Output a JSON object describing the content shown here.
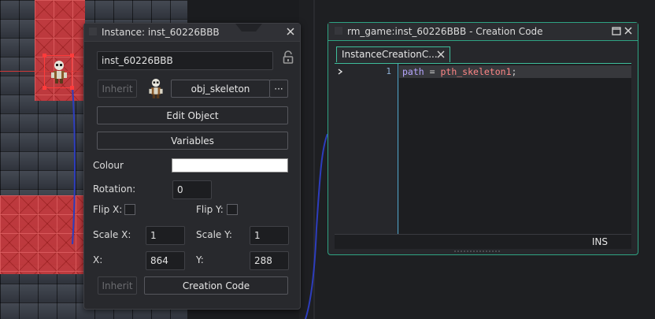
{
  "instance_panel": {
    "title": "Instance: inst_60226BBB",
    "name_value": "inst_60226BBB",
    "inherit_label": "Inherit",
    "object_name": "obj_skeleton",
    "more_label": "···",
    "edit_object_label": "Edit Object",
    "variables_label": "Variables",
    "colour_label": "Colour",
    "colour_value": "#ffffff",
    "rotation_label": "Rotation:",
    "rotation_value": "0",
    "flip_x_label": "Flip X:",
    "flip_y_label": "Flip Y:",
    "flip_x_checked": false,
    "flip_y_checked": false,
    "scale_x_label": "Scale X:",
    "scale_x_value": "1",
    "scale_y_label": "Scale Y:",
    "scale_y_value": "1",
    "x_label": "X:",
    "x_value": "864",
    "y_label": "Y:",
    "y_value": "288",
    "inherit_code_label": "Inherit",
    "creation_code_label": "Creation Code"
  },
  "code_window": {
    "title": "rm_game:inst_60226BBB - Creation Code",
    "tab_label": "InstanceCreationC...",
    "line_number": "1",
    "code": {
      "var": "path",
      "op": " = ",
      "value": "pth_skeleton1",
      "end": ";"
    },
    "status_mode": "INS"
  },
  "colors": {
    "accent": "#2fa383",
    "selection": "#ff3b3b",
    "room_red": "#c93a3e"
  },
  "icons": [
    "lock-icon",
    "close-icon",
    "maximize-icon",
    "skeleton-sprite-icon",
    "fold-arrow-icon"
  ]
}
